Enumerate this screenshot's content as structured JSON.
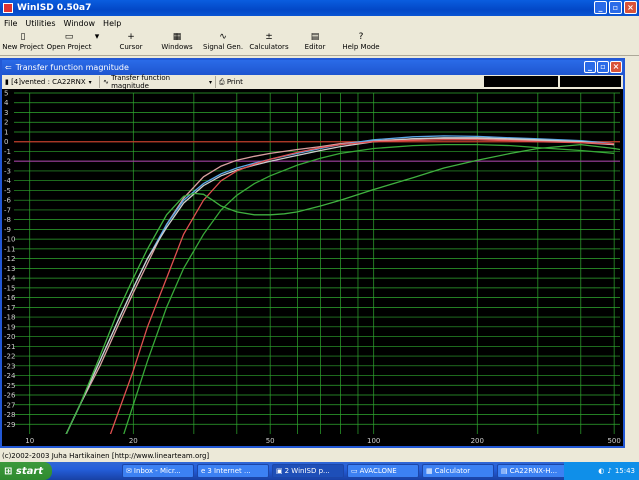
{
  "window": {
    "title": "WinISD 0.50a7"
  },
  "menu": [
    "File",
    "Utilities",
    "Window",
    "Help"
  ],
  "toolbar": [
    {
      "label": "New Project",
      "icon": "▯"
    },
    {
      "label": "Open Project",
      "icon": "▭"
    },
    {
      "label": "Cursor",
      "icon": "+"
    },
    {
      "label": "Windows",
      "icon": "▦"
    },
    {
      "label": "Signal Gen.",
      "icon": "∿"
    },
    {
      "label": "Calculators",
      "icon": "±"
    },
    {
      "label": "Editor",
      "icon": "▤"
    },
    {
      "label": "Help Mode",
      "icon": "?"
    }
  ],
  "subwindow": {
    "title": "Transfer function magnitude",
    "project_combo": "[4]vented : CA22RNX",
    "graph_combo": "Transfer function magnitude",
    "print_label": "Print"
  },
  "chart_data": {
    "type": "line",
    "xscale": "log",
    "xlim": [
      9,
      520
    ],
    "ylim": [
      -30,
      5
    ],
    "x_ticks": [
      10,
      20,
      50,
      100,
      200,
      500
    ],
    "y_ticks": [
      5,
      4,
      3,
      2,
      1,
      0,
      -1,
      -2,
      -3,
      -4,
      -5,
      -6,
      -7,
      -8,
      -9,
      -10,
      -11,
      -12,
      -13,
      -14,
      -15,
      -16,
      -17,
      -18,
      -19,
      -20,
      -21,
      -22,
      -23,
      -24,
      -25,
      -26,
      -27,
      -28,
      -29
    ],
    "reference_lines": [
      {
        "y": 0,
        "color": "#c0392b"
      },
      {
        "y": -2,
        "color": "#a040a0"
      }
    ],
    "series": [
      {
        "color": "#d9a0a0",
        "x": [
          10,
          12,
          14,
          16,
          18,
          20,
          22,
          25,
          28,
          32,
          36,
          40,
          45,
          50,
          60,
          70,
          80,
          100,
          130,
          160,
          200,
          250,
          300,
          400,
          500
        ],
        "y": [
          -37,
          -32,
          -27,
          -23,
          -19,
          -15.5,
          -12.5,
          -8.5,
          -5.8,
          -3.6,
          -2.5,
          -1.9,
          -1.5,
          -1.2,
          -0.8,
          -0.5,
          -0.2,
          0.1,
          0.3,
          0.35,
          0.3,
          0.2,
          0.1,
          -0.1,
          -0.3
        ]
      },
      {
        "color": "#5aa8e8",
        "x": [
          10,
          12,
          14,
          16,
          18,
          20,
          22,
          25,
          28,
          32,
          36,
          40,
          45,
          50,
          60,
          70,
          80,
          100,
          130,
          160,
          200,
          250,
          300,
          400,
          500
        ],
        "y": [
          -37,
          -32,
          -27,
          -22.5,
          -18.5,
          -15,
          -12,
          -8.5,
          -6,
          -4.3,
          -3.3,
          -2.7,
          -2.2,
          -1.8,
          -1.2,
          -0.7,
          -0.3,
          0.2,
          0.5,
          0.6,
          0.55,
          0.4,
          0.3,
          0.1,
          -0.2
        ]
      },
      {
        "color": "#cccccc",
        "x": [
          10,
          12,
          14,
          16,
          18,
          20,
          22,
          25,
          28,
          32,
          36,
          40,
          45,
          50,
          60,
          70,
          80,
          100,
          130,
          160,
          200,
          250,
          300,
          400,
          500
        ],
        "y": [
          -37,
          -32,
          -27,
          -22.5,
          -18.5,
          -15,
          -12,
          -8.8,
          -6.3,
          -4.5,
          -3.5,
          -2.9,
          -2.4,
          -2,
          -1.4,
          -0.9,
          -0.5,
          0,
          0.3,
          0.4,
          0.4,
          0.3,
          0.2,
          0,
          -0.3
        ]
      },
      {
        "color": "#e05050",
        "x": [
          14,
          16,
          18,
          20,
          22,
          25,
          28,
          32,
          36,
          40,
          45,
          50,
          60,
          70,
          80,
          100,
          130,
          160,
          200,
          250,
          300,
          400,
          500
        ],
        "y": [
          -37,
          -33,
          -28,
          -23.5,
          -19,
          -14,
          -9.5,
          -6,
          -4,
          -3,
          -2.3,
          -1.8,
          -1.1,
          -0.6,
          -0.3,
          0,
          0.15,
          0.2,
          0.2,
          0.1,
          0,
          -0.1,
          -0.2
        ]
      },
      {
        "color": "#40b040",
        "x": [
          10,
          12,
          14,
          16,
          18,
          20,
          22,
          25,
          28,
          30,
          32,
          34,
          36,
          40,
          45,
          50,
          55,
          60,
          70,
          80,
          100,
          130,
          160,
          200,
          250,
          300,
          400,
          500,
          520
        ],
        "y": [
          -37,
          -32,
          -27,
          -22,
          -17.5,
          -14,
          -11,
          -7.5,
          -5.6,
          -5.3,
          -5.4,
          -6,
          -6.6,
          -7.2,
          -7.5,
          -7.5,
          -7.4,
          -7.2,
          -6.6,
          -6,
          -4.9,
          -3.7,
          -2.7,
          -1.9,
          -1.2,
          -0.7,
          -0.3,
          -0.7,
          -0.8
        ]
      },
      {
        "color": "#38a838",
        "x": [
          16,
          18,
          20,
          22,
          25,
          28,
          32,
          36,
          40,
          45,
          50,
          60,
          70,
          80,
          100,
          130,
          160,
          200,
          250,
          300,
          400,
          500
        ],
        "y": [
          -37,
          -32,
          -27,
          -22.5,
          -17,
          -13,
          -9.5,
          -7,
          -5.5,
          -4.3,
          -3.5,
          -2.4,
          -1.7,
          -1.2,
          -0.7,
          -0.4,
          -0.3,
          -0.3,
          -0.4,
          -0.6,
          -0.9,
          -1.2
        ]
      }
    ]
  },
  "status": {
    "text": "(c)2002-2003 Juha Hartikainen [http://www.linearteam.org]"
  },
  "taskbar": {
    "start": "start",
    "tasks": [
      {
        "label": "Inbox - Micr..."
      },
      {
        "label": "3 Internet ..."
      },
      {
        "label": "2 WinISD p..."
      },
      {
        "label": "AVACLONE"
      },
      {
        "label": "Calculator"
      },
      {
        "label": "CA22RNX-H..."
      }
    ],
    "clock": "15:43"
  }
}
